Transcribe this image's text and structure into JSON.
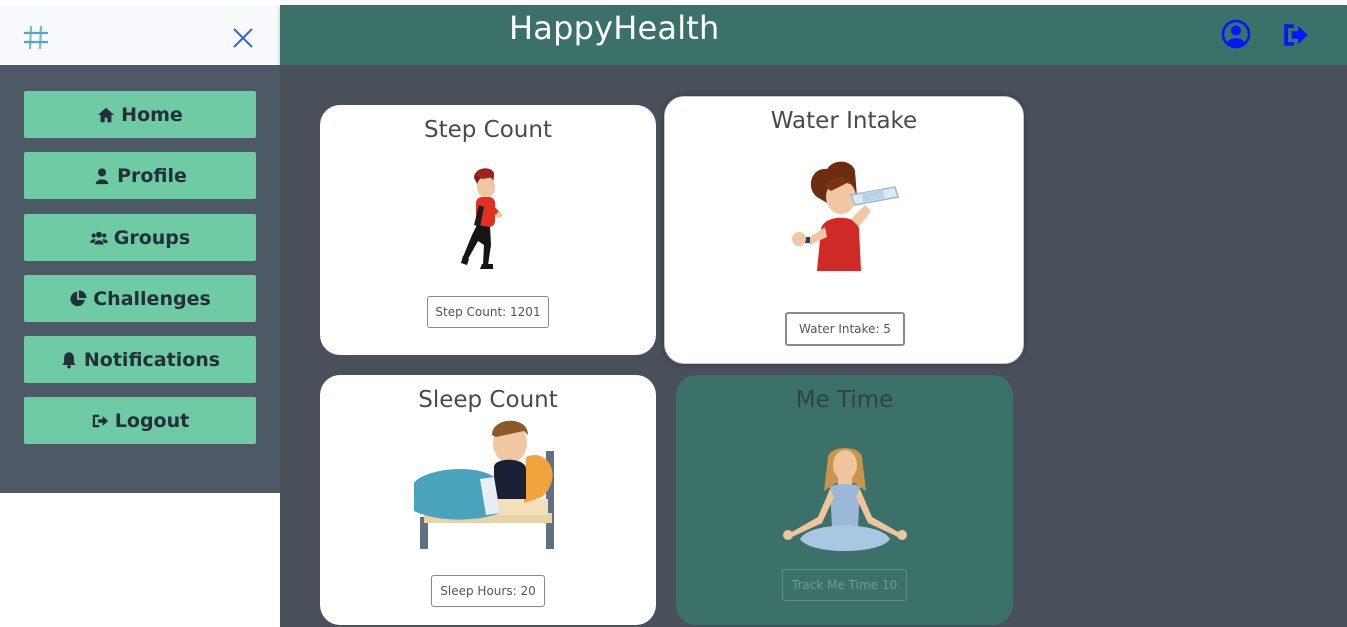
{
  "header": {
    "title": "HappyHealth",
    "icons": [
      "user-circle-icon",
      "sign-out-icon"
    ]
  },
  "sidebar": {
    "brand_icon": "hash-icon",
    "close_icon": "close-icon",
    "items": [
      {
        "label": "Home",
        "icon": "home-icon"
      },
      {
        "label": "Profile",
        "icon": "user-icon"
      },
      {
        "label": "Groups",
        "icon": "users-icon"
      },
      {
        "label": "Challenges",
        "icon": "pie-chart-icon"
      },
      {
        "label": "Notifications",
        "icon": "bell-icon"
      },
      {
        "label": "Logout",
        "icon": "sign-out-icon"
      }
    ]
  },
  "cards": {
    "step": {
      "title": "Step Count",
      "button": "Step Count: 1201"
    },
    "water": {
      "title": "Water Intake",
      "button": "Water Intake: 5"
    },
    "sleep": {
      "title": "Sleep Count",
      "button": "Sleep Hours: 20"
    },
    "me": {
      "title": "Me Time",
      "button": "Track Me Time 10"
    }
  },
  "colors": {
    "header": "#3b7169",
    "sidebar": "#4d5a66",
    "nav_button": "#6fcba3",
    "main_bg": "#4a505a",
    "icon_blue": "#0018ff"
  }
}
